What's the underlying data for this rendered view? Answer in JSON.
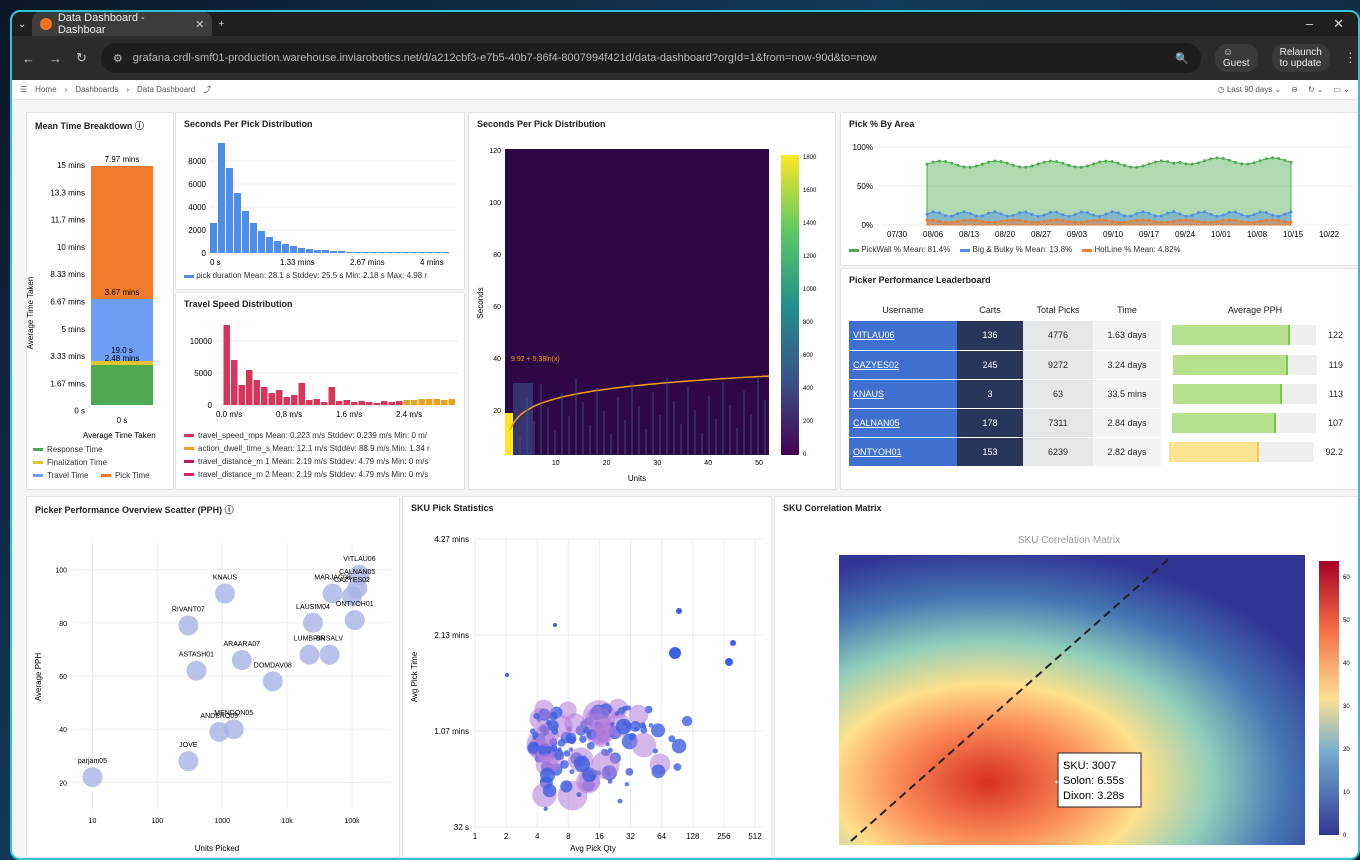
{
  "browser": {
    "tab_title": "Data Dashboard - Dashboar",
    "url": "grafana.crdl-smf01-production.warehouse.inviarobotics.net/d/a212cbf3-e7b5-40b7-86f4-8007994f421d/data-dashboard?orgId=1&from=now-90d&to=now",
    "guest": "Guest",
    "relaunch": "Relaunch to update"
  },
  "grafana": {
    "breadcrumb": [
      "Home",
      "Dashboards",
      "Data Dashboard"
    ],
    "time_range": "Last 90 days"
  },
  "mean_time": {
    "title": "Mean Time Breakdown",
    "ylabel": "Average Time Taken",
    "xlabel": "Average Time Taken",
    "xtick": "0 s",
    "yticks": [
      "15 mins",
      "13.3 mins",
      "11.7 mins",
      "10 mins",
      "8.33 mins",
      "6.67 mins",
      "5 mins",
      "3.33 mins",
      "1.67 mins",
      "0 s"
    ],
    "labels": [
      "7.97 mins",
      "3.67 mins",
      "19.0 s",
      "2.48 mins"
    ],
    "legend": [
      "Response Time",
      "Finalization Time",
      "Travel Time",
      "Pick Time"
    ]
  },
  "spp1": {
    "title": "Seconds Per Pick Distribution",
    "yticks": [
      "8000",
      "6000",
      "4000",
      "2000",
      "0"
    ],
    "xticks": [
      "0 s",
      "1.33 mins",
      "2.67 mins",
      "4 mins"
    ],
    "legend": "pick duration  Mean: 28.1 s  Stddev: 25.5 s  Min: 2.18 s  Max: 4.98 r"
  },
  "travel": {
    "title": "Travel Speed Distribution",
    "yticks": [
      "10000",
      "5000",
      "0"
    ],
    "xticks": [
      "0.0 m/s",
      "0.8 m/s",
      "1.6 m/s",
      "2.4 m/s"
    ],
    "legend": [
      "travel_speed_mps  Mean: 0.223 m/s  Stddev: 0.239 m/s  Min: 0 m/",
      "action_dwell_time_s  Mean: 12.1 m/s  Stddev: 88.9 m/s  Min: 1.34 r",
      "travel_distance_m 1  Mean: 2.19 m/s  Stddev: 4.79 m/s  Min: 0 m/s",
      "travel_distance_m 2  Mean: 2.19 m/s  Stddev: 4.79 m/s  Min: 0 m/s"
    ]
  },
  "heat": {
    "title": "Seconds Per Pick Distribution",
    "ylabel": "Seconds",
    "xlabel": "Units",
    "yticks": [
      "120",
      "100",
      "80",
      "60",
      "40",
      "20"
    ],
    "xticks": [
      "10",
      "20",
      "30",
      "40",
      "50"
    ],
    "cticks": [
      "1800",
      "1600",
      "1400",
      "1200",
      "1000",
      "800",
      "600",
      "400",
      "200",
      "0"
    ],
    "fit": "9.92 + 5.38ln(x)"
  },
  "pick_area": {
    "title": "Pick % By Area",
    "yticks": [
      "100%",
      "50%",
      "0%"
    ],
    "xticks": [
      "07/30",
      "08/06",
      "08/13",
      "08/20",
      "08/27",
      "09/03",
      "09/10",
      "09/17",
      "09/24",
      "10/01",
      "10/08",
      "10/15",
      "10/22"
    ],
    "legend": [
      "PickWall %  Mean: 81.4%",
      "Big & Bulky %  Mean: 13.8%",
      "HotLine %  Mean: 4.82%"
    ]
  },
  "leaderboard": {
    "title": "Picker Performance Leaderboard",
    "headers": [
      "Username",
      "Carts",
      "Total Picks",
      "Time",
      "Average PPH"
    ],
    "rows": [
      {
        "user": "VITLAU06",
        "carts": "136",
        "picks": "4776",
        "time": "1.63 days",
        "pph": "122",
        "frac": 0.82
      },
      {
        "user": "CAZYES02",
        "carts": "245",
        "picks": "9272",
        "time": "3.24 days",
        "pph": "119",
        "frac": 0.8
      },
      {
        "user": "KNAUS",
        "carts": "3",
        "picks": "63",
        "time": "33.5 mins",
        "pph": "113",
        "frac": 0.76
      },
      {
        "user": "CALNAN05",
        "carts": "178",
        "picks": "7311",
        "time": "2.84 days",
        "pph": "107",
        "frac": 0.72
      },
      {
        "user": "ONTYOH01",
        "carts": "153",
        "picks": "6239",
        "time": "2.82 days",
        "pph": "92.2",
        "frac": 0.62
      }
    ]
  },
  "scatter": {
    "title": "Picker Performance Overview Scatter (PPH)",
    "xlabel": "Units Picked",
    "ylabel": "Average PPH",
    "xticks": [
      "10",
      "100",
      "1000",
      "10k",
      "100k"
    ],
    "yticks": [
      "100",
      "80",
      "60",
      "40",
      "20"
    ],
    "points": [
      [
        "VITLAU06",
        130000,
        98
      ],
      [
        "CALNAN05",
        120000,
        93
      ],
      [
        "CAZYES02",
        100000,
        90
      ],
      [
        "MARJAC08",
        50000,
        91
      ],
      [
        "ONTYOH01",
        110000,
        81
      ],
      [
        "KNAUS",
        1100,
        91
      ],
      [
        "RIVANT07",
        300,
        79
      ],
      [
        "LAUSIM04",
        25000,
        80
      ],
      [
        "LUMBRIN",
        22000,
        68
      ],
      [
        "BRSALV",
        45000,
        68
      ],
      [
        "ARAARA07",
        2000,
        66
      ],
      [
        "ASTASH01",
        400,
        62
      ],
      [
        "DOMDAV08",
        6000,
        58
      ],
      [
        "MENDON05",
        1500,
        40
      ],
      [
        "ANDERO09",
        900,
        39
      ],
      [
        "JOVE",
        300,
        28
      ],
      [
        "parjam05",
        10,
        22
      ]
    ]
  },
  "sku": {
    "title": "SKU Pick Statistics",
    "xlabel": "Avg Pick Qty",
    "ylabel": "Avg Pick Time",
    "yticks": [
      "4.27 mins",
      "2.13 mins",
      "1.07 mins",
      "32 s"
    ],
    "xticks": [
      "1",
      "2",
      "4",
      "8",
      "16",
      "32",
      "64",
      "128",
      "256",
      "512"
    ]
  },
  "corr": {
    "title": "SKU Correlation Matrix",
    "inner_title": "SKU Correlation Matrix",
    "tooltip": [
      "SKU: 3007",
      "Solon: 6.55s",
      "Dixon: 3.28s"
    ],
    "cticks": [
      "60",
      "50",
      "40",
      "30",
      "20",
      "10",
      "0"
    ]
  },
  "colors": {
    "pick": "#ef7b2b",
    "travel": "#6f9ef6",
    "final": "#e3c42c",
    "response": "#4eaa50",
    "hist": "#4f8ee6",
    "travel_hist": "#d8355b",
    "leader_bar": "#b6e08c"
  }
}
